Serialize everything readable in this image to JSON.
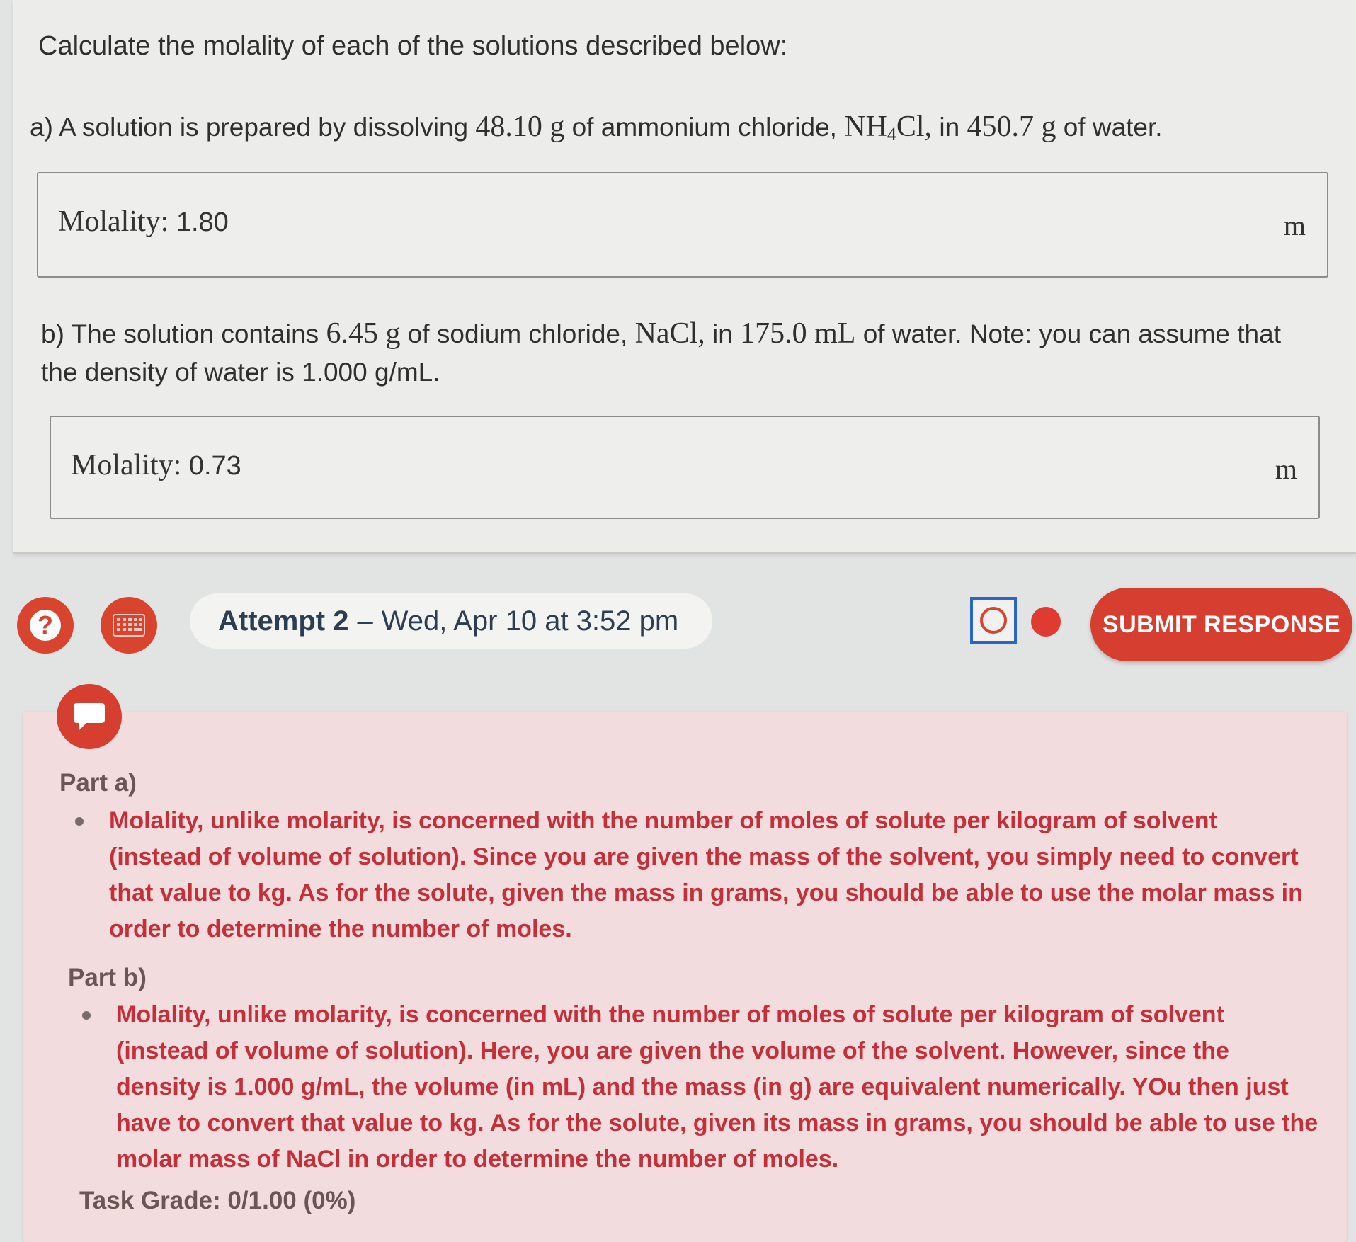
{
  "question": {
    "title": "Calculate the molality of each of the solutions described below:",
    "part_a": {
      "prefix": "a) A solution is prepared by dissolving",
      "mass": "48.10 g",
      "mid1": "of ammonium chloride,",
      "formula_main": "NH",
      "formula_sub": "4",
      "formula_end": "Cl,",
      "mid2": "in",
      "water_mass": "450.7 g",
      "suffix": "of water."
    },
    "answer_a": {
      "label": "Molality:",
      "value": "1.80",
      "unit": "m"
    },
    "part_b": {
      "prefix": "b) The solution contains",
      "mass": "6.45 g",
      "mid1": "of sodium chloride,",
      "formula": "NaCl,",
      "mid2": "in",
      "volume": "175.0 mL",
      "suffix": "of water. Note: you can assume that",
      "line2": "the density of water is 1.000 g/mL."
    },
    "answer_b": {
      "label": "Molality:",
      "value": "0.73",
      "unit": "m"
    }
  },
  "toolbar": {
    "help_icon": "question-mark-icon",
    "calc_icon": "calculator-icon",
    "attempt_label": "Attempt 2",
    "attempt_separator": "–",
    "attempt_date": "Wed, Apr 10 at 3:52 pm",
    "submit_label": "SUBMIT RESPONSE"
  },
  "feedback": {
    "icon": "speech-bubble-icon",
    "part_a_title": "Part a)",
    "part_a_lines": [
      "Molality, unlike molarity, is concerned with the number of moles of solute per kilogram of solvent",
      "(instead of volume of solution). Since you are given the mass of the solvent, you simply need to convert",
      "that value to kg. As for the solute, given the mass in grams, you should be able to use the molar mass in",
      "order to determine the number of moles."
    ],
    "part_b_title": "Part b)",
    "part_b_lines": [
      "Molality, unlike molarity, is concerned with the number of moles of solute per kilogram of solvent",
      "(instead of volume of solution). Here, you are given the volume of the solvent. However, since the",
      "density is 1.000 g/mL, the volume (in mL) and the mass (in g) are equivalent numerically. YOu then just",
      "have to convert that value to kg. As for the solute, given its mass in grams, you should be able to use the",
      "molar mass of NaCl in order to determine the number of moles."
    ],
    "grade": "Task Grade: 0/1.00 (0%)"
  },
  "colors": {
    "accent_red": "#d63f2f",
    "feedback_text": "#c3303a",
    "status_blue": "#2b66c4"
  }
}
